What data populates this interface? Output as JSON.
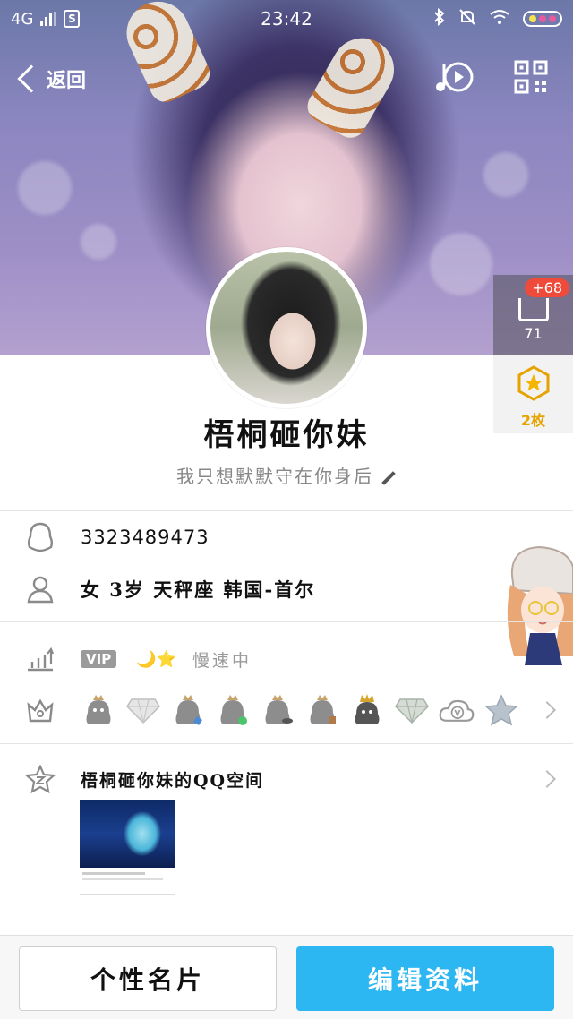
{
  "status_bar": {
    "network": "4G",
    "time": "23:42"
  },
  "nav": {
    "back_label": "返回"
  },
  "profile": {
    "nickname": "梧桐砸你妹",
    "signature": "我只想默默守在你身后",
    "qq_number": "3323489473",
    "details": "女  3岁  天秤座  韩国-首尔"
  },
  "side_widgets": {
    "like_badge": "+68",
    "like_count": "71",
    "medal_count": "2枚"
  },
  "vip": {
    "tag": "VIP",
    "status": "慢速中"
  },
  "badges": [
    "qq-penguin-icon",
    "diamond-icon",
    "qq-penguin-icon",
    "qq-penguin-icon",
    "qq-penguin-icon",
    "qq-penguin-icon",
    "qq-penguin-crown-icon",
    "diamond-icon",
    "cloud-v-icon",
    "star-icon"
  ],
  "qzone": {
    "title": "梧桐砸你妹的QQ空间"
  },
  "buttons": {
    "card_label": "个性名片",
    "edit_label": "编辑资料"
  },
  "colors": {
    "edit_button": "#2cb7f2",
    "like_badge": "#f04a3b",
    "medal": "#e6a300"
  }
}
